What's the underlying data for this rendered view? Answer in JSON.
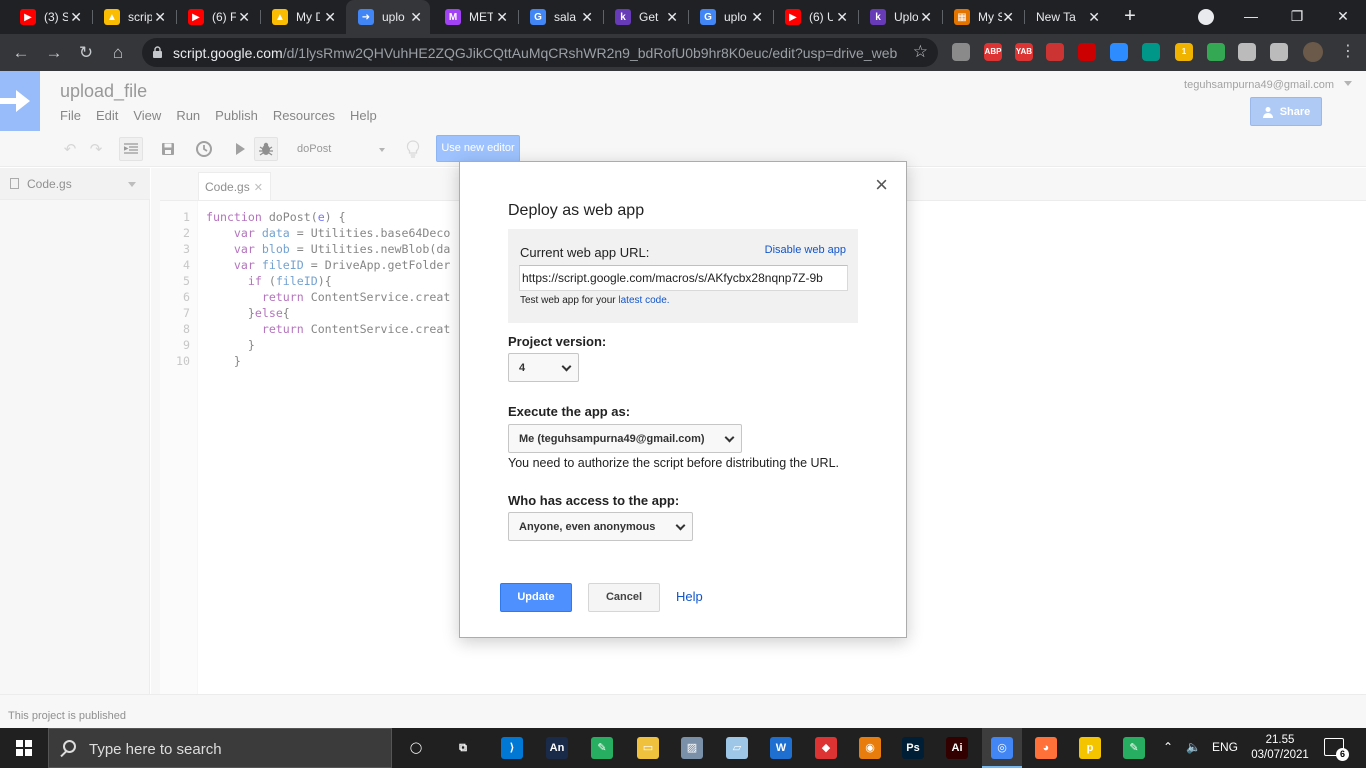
{
  "browser": {
    "tabs": [
      {
        "title": "(3) S",
        "icon": "youtube-icon",
        "color": "#ff0000"
      },
      {
        "title": "scrip",
        "icon": "google-drive-icon",
        "color": "#fbbc04"
      },
      {
        "title": "(6) F",
        "icon": "youtube-icon",
        "color": "#ff0000"
      },
      {
        "title": "My D",
        "icon": "google-drive-icon",
        "color": "#fbbc04"
      },
      {
        "title": "uplo",
        "icon": "apps-script-icon",
        "color": "#4285f4",
        "active": true
      },
      {
        "title": "MET",
        "icon": "app-icon",
        "color": "#a142f4"
      },
      {
        "title": "sala",
        "icon": "google-icon",
        "color": "#4285f4"
      },
      {
        "title": "Get",
        "icon": "kodular-icon",
        "color": "#673ab7"
      },
      {
        "title": "uplo",
        "icon": "google-icon",
        "color": "#4285f4"
      },
      {
        "title": "(6) U",
        "icon": "youtube-icon",
        "color": "#ff0000"
      },
      {
        "title": "Uplo",
        "icon": "kodular-icon",
        "color": "#673ab7"
      },
      {
        "title": "My S",
        "icon": "sheets-icon",
        "color": "#e37400"
      },
      {
        "title": "New Tab",
        "icon": "",
        "color": ""
      }
    ],
    "url_domain": "script.google.com",
    "url_path": "/d/1lysRmw2QHVuhHE2ZQGJikCQttAuMqCRshWR2n9_bdRofU0b9hr8K0euc/edit?usp=drive_web",
    "extensions": [
      {
        "label": "",
        "color": "#8a8a8a"
      },
      {
        "label": "ABP",
        "color": "#d33"
      },
      {
        "label": "YAB",
        "color": "#d33"
      },
      {
        "label": "",
        "color": "#c33"
      },
      {
        "label": "",
        "color": "#c00"
      },
      {
        "label": "",
        "color": "#2d8cff"
      },
      {
        "label": "",
        "color": "#009688"
      },
      {
        "label": "1",
        "color": "#f0b400"
      },
      {
        "label": "",
        "color": "#34a853"
      },
      {
        "label": "",
        "color": "#bbb"
      },
      {
        "label": "",
        "color": "#bbb"
      }
    ]
  },
  "app": {
    "project_title": "upload_file",
    "menu": [
      "File",
      "Edit",
      "View",
      "Run",
      "Publish",
      "Resources",
      "Help"
    ],
    "account": "teguhsampurna49@gmail.com",
    "share_label": "Share",
    "function_select": "doPost",
    "new_editor_label": "Use new editor",
    "file_name": "Code.gs",
    "code_tab": "Code.gs",
    "code_lines": [
      "function doPost(e) {",
      "    var data = Utilities.base64Deco",
      "    var blob = Utilities.newBlob(da",
      "    var fileID = DriveApp.getFolder",
      "      if (fileID){",
      "        return ContentService.creat",
      "      }else{",
      "        return ContentService.creat",
      "      }",
      "    }"
    ],
    "status": "This project is published"
  },
  "dialog": {
    "title": "Deploy as web app",
    "url_label": "Current web app URL:",
    "disable_label": "Disable web app",
    "url_value": "https://script.google.com/macros/s/AKfycbx28nqnp7Z-9b",
    "test_prefix": "Test web app for your ",
    "test_link": "latest code.",
    "project_version_label": "Project version:",
    "project_version_value": "4",
    "execute_label": "Execute the app as:",
    "execute_value": "Me (teguhsampurna49@gmail.com)",
    "auth_note": "You need to authorize the script before distributing the URL.",
    "access_label": "Who has access to the app:",
    "access_value": "Anyone, even anonymous",
    "update_label": "Update",
    "cancel_label": "Cancel",
    "help_label": "Help",
    "close_glyph": "×"
  },
  "taskbar": {
    "search_placeholder": "Type here to search",
    "language": "ENG",
    "time": "21.55",
    "date": "03/07/2021",
    "notification_count": "6"
  }
}
